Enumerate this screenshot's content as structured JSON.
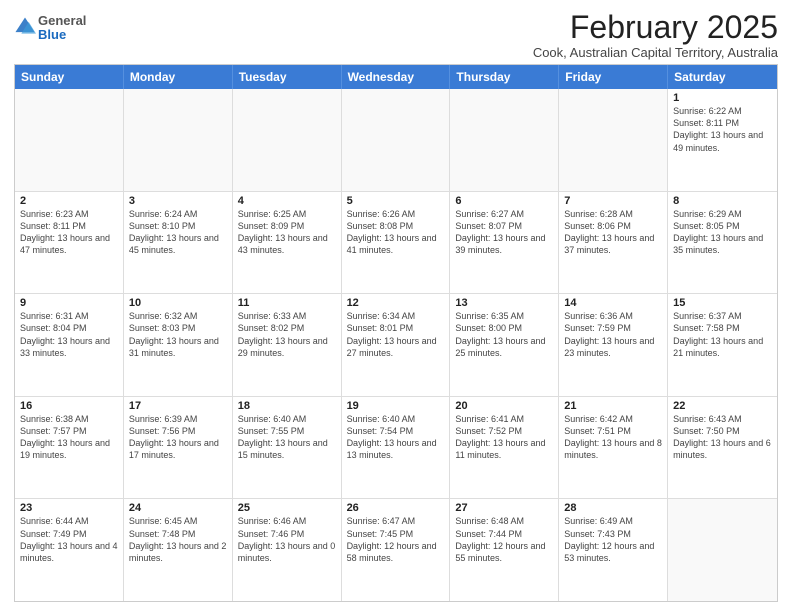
{
  "logo": {
    "general": "General",
    "blue": "Blue"
  },
  "header": {
    "title": "February 2025",
    "subtitle": "Cook, Australian Capital Territory, Australia"
  },
  "weekdays": [
    "Sunday",
    "Monday",
    "Tuesday",
    "Wednesday",
    "Thursday",
    "Friday",
    "Saturday"
  ],
  "weeks": [
    [
      {
        "day": "",
        "empty": true
      },
      {
        "day": "",
        "empty": true
      },
      {
        "day": "",
        "empty": true
      },
      {
        "day": "",
        "empty": true
      },
      {
        "day": "",
        "empty": true
      },
      {
        "day": "",
        "empty": true
      },
      {
        "day": "1",
        "info": "Sunrise: 6:22 AM\nSunset: 8:11 PM\nDaylight: 13 hours\nand 49 minutes."
      }
    ],
    [
      {
        "day": "2",
        "info": "Sunrise: 6:23 AM\nSunset: 8:11 PM\nDaylight: 13 hours\nand 47 minutes."
      },
      {
        "day": "3",
        "info": "Sunrise: 6:24 AM\nSunset: 8:10 PM\nDaylight: 13 hours\nand 45 minutes."
      },
      {
        "day": "4",
        "info": "Sunrise: 6:25 AM\nSunset: 8:09 PM\nDaylight: 13 hours\nand 43 minutes."
      },
      {
        "day": "5",
        "info": "Sunrise: 6:26 AM\nSunset: 8:08 PM\nDaylight: 13 hours\nand 41 minutes."
      },
      {
        "day": "6",
        "info": "Sunrise: 6:27 AM\nSunset: 8:07 PM\nDaylight: 13 hours\nand 39 minutes."
      },
      {
        "day": "7",
        "info": "Sunrise: 6:28 AM\nSunset: 8:06 PM\nDaylight: 13 hours\nand 37 minutes."
      },
      {
        "day": "8",
        "info": "Sunrise: 6:29 AM\nSunset: 8:05 PM\nDaylight: 13 hours\nand 35 minutes."
      }
    ],
    [
      {
        "day": "9",
        "info": "Sunrise: 6:31 AM\nSunset: 8:04 PM\nDaylight: 13 hours\nand 33 minutes."
      },
      {
        "day": "10",
        "info": "Sunrise: 6:32 AM\nSunset: 8:03 PM\nDaylight: 13 hours\nand 31 minutes."
      },
      {
        "day": "11",
        "info": "Sunrise: 6:33 AM\nSunset: 8:02 PM\nDaylight: 13 hours\nand 29 minutes."
      },
      {
        "day": "12",
        "info": "Sunrise: 6:34 AM\nSunset: 8:01 PM\nDaylight: 13 hours\nand 27 minutes."
      },
      {
        "day": "13",
        "info": "Sunrise: 6:35 AM\nSunset: 8:00 PM\nDaylight: 13 hours\nand 25 minutes."
      },
      {
        "day": "14",
        "info": "Sunrise: 6:36 AM\nSunset: 7:59 PM\nDaylight: 13 hours\nand 23 minutes."
      },
      {
        "day": "15",
        "info": "Sunrise: 6:37 AM\nSunset: 7:58 PM\nDaylight: 13 hours\nand 21 minutes."
      }
    ],
    [
      {
        "day": "16",
        "info": "Sunrise: 6:38 AM\nSunset: 7:57 PM\nDaylight: 13 hours\nand 19 minutes."
      },
      {
        "day": "17",
        "info": "Sunrise: 6:39 AM\nSunset: 7:56 PM\nDaylight: 13 hours\nand 17 minutes."
      },
      {
        "day": "18",
        "info": "Sunrise: 6:40 AM\nSunset: 7:55 PM\nDaylight: 13 hours\nand 15 minutes."
      },
      {
        "day": "19",
        "info": "Sunrise: 6:40 AM\nSunset: 7:54 PM\nDaylight: 13 hours\nand 13 minutes."
      },
      {
        "day": "20",
        "info": "Sunrise: 6:41 AM\nSunset: 7:52 PM\nDaylight: 13 hours\nand 11 minutes."
      },
      {
        "day": "21",
        "info": "Sunrise: 6:42 AM\nSunset: 7:51 PM\nDaylight: 13 hours\nand 8 minutes."
      },
      {
        "day": "22",
        "info": "Sunrise: 6:43 AM\nSunset: 7:50 PM\nDaylight: 13 hours\nand 6 minutes."
      }
    ],
    [
      {
        "day": "23",
        "info": "Sunrise: 6:44 AM\nSunset: 7:49 PM\nDaylight: 13 hours\nand 4 minutes."
      },
      {
        "day": "24",
        "info": "Sunrise: 6:45 AM\nSunset: 7:48 PM\nDaylight: 13 hours\nand 2 minutes."
      },
      {
        "day": "25",
        "info": "Sunrise: 6:46 AM\nSunset: 7:46 PM\nDaylight: 13 hours\nand 0 minutes."
      },
      {
        "day": "26",
        "info": "Sunrise: 6:47 AM\nSunset: 7:45 PM\nDaylight: 12 hours\nand 58 minutes."
      },
      {
        "day": "27",
        "info": "Sunrise: 6:48 AM\nSunset: 7:44 PM\nDaylight: 12 hours\nand 55 minutes."
      },
      {
        "day": "28",
        "info": "Sunrise: 6:49 AM\nSunset: 7:43 PM\nDaylight: 12 hours\nand 53 minutes."
      },
      {
        "day": "",
        "empty": true
      }
    ]
  ]
}
